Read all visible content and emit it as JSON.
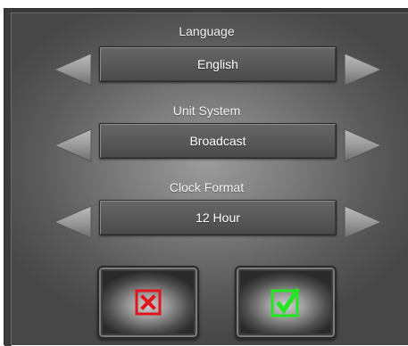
{
  "settings": {
    "language": {
      "label": "Language",
      "value": "English"
    },
    "unit_system": {
      "label": "Unit System",
      "value": "Broadcast"
    },
    "clock_format": {
      "label": "Clock Format",
      "value": "12 Hour"
    }
  },
  "icons": {
    "prev": "arrow-left-icon",
    "next": "arrow-right-icon",
    "cancel": "cancel-x-icon",
    "confirm": "checkmark-icon"
  },
  "colors": {
    "cancel": "#e0161c",
    "confirm": "#22e61f"
  }
}
